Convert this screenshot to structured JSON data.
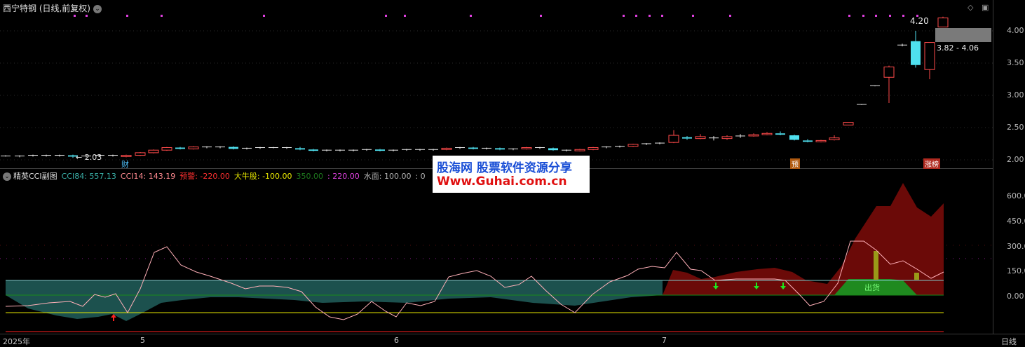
{
  "window": {
    "title": "西宁特钢 (日线,前复权)",
    "tr_icons": [
      "◇",
      "▣"
    ]
  },
  "main_chart": {
    "y_ticks": [
      "4.00",
      "3.50",
      "3.00",
      "2.50",
      "2.00"
    ],
    "high_label": "4.20",
    "low_label": "← 2.03",
    "range_label": "3.82 - 4.06",
    "marker_cai": "财",
    "marker_yu": "预",
    "marker_zhangbang": "涨榜"
  },
  "indicator": {
    "name": "精英CCI副图",
    "cci84": "CCI84: 557.13",
    "cci14": "CCI14: 143.19",
    "yujing": "预警: -220.00",
    "daniu": "大牛股: -100.00",
    "v350": "350.00",
    "v220": ": 220.00",
    "shuimian": "水面: 100.00",
    "zero": ": 0",
    "chuhuo": "出货",
    "y_ticks": [
      "600.00",
      "450.00",
      "300.00",
      "150.00",
      "0.00"
    ]
  },
  "x_axis": {
    "labels": [
      "2025年",
      "5",
      "6",
      "7"
    ],
    "period": "日线"
  },
  "watermark": {
    "line1": "股海网 股票软件资源分享",
    "line2": "Www.Guhai.com.cn"
  },
  "colors": {
    "up": "#ff4a4a",
    "down": "#4fe0ef",
    "cci84_fill": "#1f5a57",
    "cci14_line": "#ffb0b8",
    "red_area": "#6b0a08",
    "green_area": "#1f8a1f",
    "magenta": "#e040e0",
    "yellow": "#e6e600"
  }
}
